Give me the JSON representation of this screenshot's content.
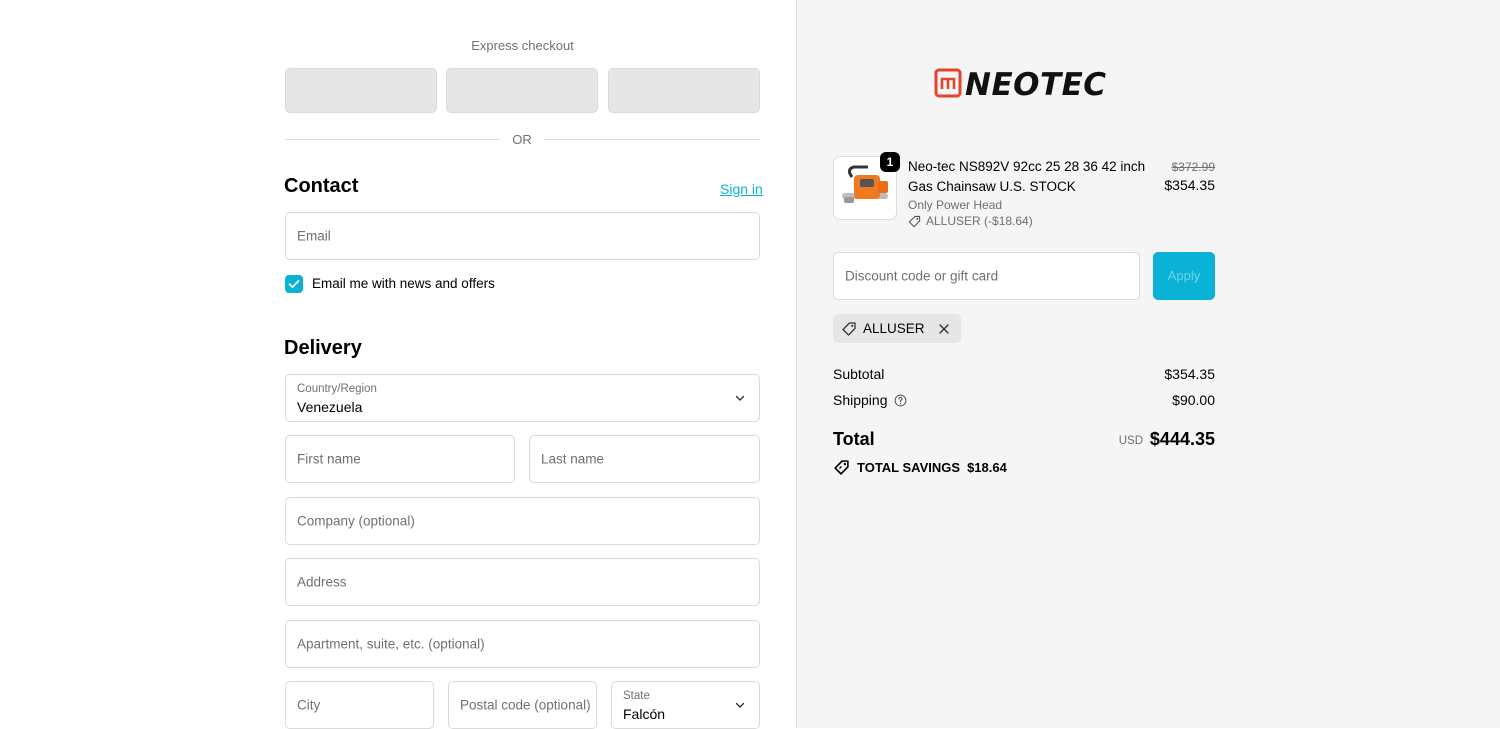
{
  "express": {
    "title": "Express checkout",
    "or": "OR"
  },
  "contact": {
    "heading": "Contact",
    "sign_in": "Sign in",
    "email_placeholder": "Email",
    "newsletter_label": "Email me with news and offers",
    "newsletter_checked": true
  },
  "delivery": {
    "heading": "Delivery",
    "country_label": "Country/Region",
    "country_value": "Venezuela",
    "first_name": "First name",
    "last_name": "Last name",
    "company": "Company (optional)",
    "address": "Address",
    "apartment": "Apartment, suite, etc. (optional)",
    "city": "City",
    "postal": "Postal code (optional)",
    "state_label": "State",
    "state_value": "Falcón"
  },
  "brand": {
    "logo_text": "NEOTEC"
  },
  "summary": {
    "product": {
      "qty": "1",
      "name": "Neo-tec NS892V 92cc 25 28 36 42 inch Gas Chainsaw U.S. STOCK",
      "variant": "Only Power Head",
      "discount": "ALLUSER (-$18.64)",
      "price_old": "$372.99",
      "price_new": "$354.35"
    },
    "discount_placeholder": "Discount code or gift card",
    "apply_label": "Apply",
    "applied_code": "ALLUSER",
    "subtotal_label": "Subtotal",
    "subtotal_value": "$354.35",
    "shipping_label": "Shipping",
    "shipping_value": "$90.00",
    "total_label": "Total",
    "currency": "USD",
    "total_value": "$444.35",
    "savings_label": "TOTAL SAVINGS",
    "savings_value": "$18.64"
  },
  "colors": {
    "accent": "#0ab3d6",
    "brand_red": "#e2452b"
  }
}
